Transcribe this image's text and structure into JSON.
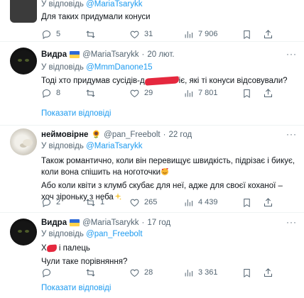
{
  "tweets": [
    {
      "reply_prefix": "У відповідь",
      "reply_to": "@MariaTsarykk",
      "text_lines": [
        "Для таких придумали конуси"
      ],
      "stats": {
        "replies": "5",
        "retweets": "",
        "likes": "31",
        "views": "7 906"
      }
    },
    {
      "name": "Видра",
      "handle": "@MariaTsarykk",
      "dot": "·",
      "time": "20 лют.",
      "reply_prefix": "У відповідь",
      "reply_to": "@MmmDanone15",
      "text_before": "Тоді хто придумав сусідів-д",
      "text_after": "",
      "text_after_2": "іє, які ті конуси відсовували?",
      "stats": {
        "replies": "8",
        "retweets": "",
        "likes": "29",
        "views": "7 801"
      }
    },
    {
      "name": "неймовірне",
      "handle": "@pan_Freebolt",
      "dot": "·",
      "time": "22 год",
      "reply_prefix": "У відповідь",
      "reply_to": "@MariaTsarykk",
      "paragraph_1": "Також романтично, коли він перевищує швидкість, підрізає і бикує, коли вона спішить на ноготочки",
      "paragraph_2": "Або коли квіти з клумб скубає для неї, адже для своєї коханої – хоч зіроньку з неба",
      "stats": {
        "replies": "2",
        "retweets": "1",
        "likes": "265",
        "views": "4 439"
      }
    },
    {
      "name": "Видра",
      "handle": "@MariaTsarykk",
      "dot": "·",
      "time": "17 год",
      "reply_prefix": "У відповідь",
      "reply_to": "@pan_Freebolt",
      "line_1_start": "Х",
      "line_1_end": " і палець",
      "line_2": "Чули таке порівняння?",
      "stats": {
        "replies": "",
        "retweets": "",
        "likes": "28",
        "views": "3 361"
      }
    }
  ],
  "show_replies_label": "Показати відповіді",
  "more_label": "···",
  "colors": {
    "link": "#1d9bf0",
    "muted": "#536471",
    "border": "#eff3f4",
    "redaction": "#e5283e"
  },
  "icons": [
    "reply-icon",
    "retweet-icon",
    "like-icon",
    "views-icon",
    "bookmark-icon",
    "share-icon",
    "ukraine-flag-icon",
    "sunflower-icon",
    "smiling-hearts-emoji",
    "sparkles-emoji"
  ]
}
